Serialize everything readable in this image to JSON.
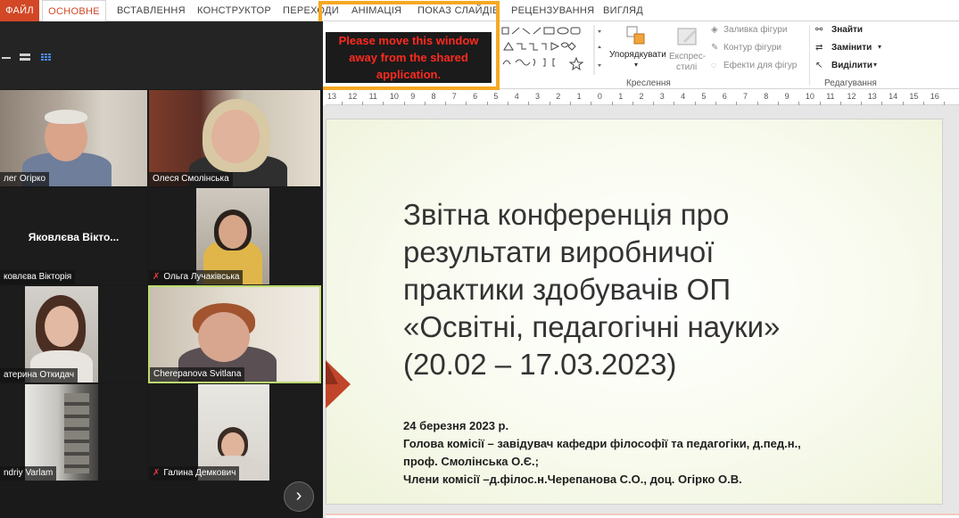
{
  "ribbon": {
    "tabs": [
      "ФАЙЛ",
      "ОСНОВНЕ",
      "ВСТАВЛЕННЯ",
      "КОНСТРУКТОР",
      "ПЕРЕХОДИ",
      "АНІМАЦІЯ",
      "ПОКАЗ СЛАЙДІВ",
      "РЕЦЕНЗУВАННЯ",
      "ВИГЛЯД"
    ],
    "arrange_label": "Упорядкувати",
    "quick_styles_line1": "Експрес-",
    "quick_styles_line2": "стилі",
    "shape_fill": "Заливка фігури",
    "shape_outline": "Контур фігури",
    "shape_effects": "Ефекти для фігур",
    "find": "Знайти",
    "replace": "Замінити",
    "select": "Виділити",
    "group_drawing": "Креслення",
    "group_editing": "Редагування"
  },
  "ruler": {
    "numbers": [
      "13",
      "12",
      "11",
      "10",
      "9",
      "8",
      "7",
      "6",
      "5",
      "4",
      "3",
      "2",
      "1",
      "0",
      "1",
      "2",
      "3",
      "4",
      "5",
      "6",
      "7",
      "8",
      "9",
      "10",
      "11",
      "12",
      "13",
      "14",
      "15",
      "16"
    ]
  },
  "share_overlay": {
    "message_line1": "Please move this window",
    "message_line2": "away from the shared",
    "message_line3": "application."
  },
  "participants": [
    {
      "name": "Олег Огірко",
      "muted": false
    },
    {
      "name": "Олеся Смолінська",
      "muted": false
    },
    {
      "name": "Яковлєва Вікторія",
      "muted": false,
      "display": "Яковлєва Вікто..."
    },
    {
      "name": "Ольга Лучаківська",
      "muted": true
    },
    {
      "name": "Катерина Откидач",
      "muted": false
    },
    {
      "name": "Cherepanova Svitlana",
      "muted": false
    },
    {
      "name": "Andriy Varlam",
      "muted": false
    },
    {
      "name": "Галина Демкович",
      "muted": true
    }
  ],
  "participant_labels": {
    "p1": "лег Огірко",
    "p2": "Олеся Смолінська",
    "p3_center": "Яковлєва Вікто...",
    "p3": "ковлєва Вікторія",
    "p4": "Ольга Лучаківська",
    "p5": "атерина Откидач",
    "p6": "Cherepanova Svitlana",
    "p7": "ndriy Varlam",
    "p8": "Галина Демкович"
  },
  "icons": {
    "mute": "✗",
    "next": "›"
  },
  "slide": {
    "title_lines": [
      "Звітна конференція про",
      "результати виробничої",
      "практики здобувачів ОП",
      "«Освітні, педагогічні науки»",
      "(20.02 – 17.03.2023)"
    ],
    "subtitle_lines": [
      "24 березня 2023 р.",
      "Голова комісії – завідувач кафедри філософії та педагогіки, д.пед.н.,",
      "проф. Смолінська О.Є.;",
      "Члени комісії –д.філос.н.Черепанова С.О., доц. Огірко О.В."
    ]
  },
  "colors": {
    "accent": "#d24726",
    "share_border": "#f7a823",
    "warning_text": "#ff2a1f",
    "speaker_border": "#bddc6f",
    "slide_arrow": "#c0452a"
  }
}
